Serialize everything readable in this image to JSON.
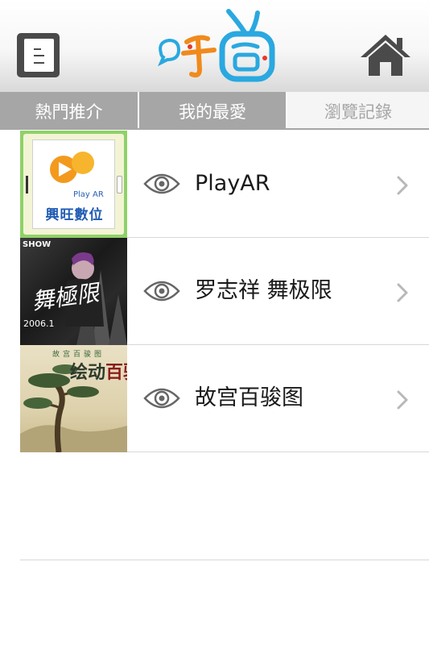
{
  "header": {
    "menu_icon": "notebook-icon",
    "logo_icon": "brand-logo",
    "home_icon": "home-icon"
  },
  "tabs": [
    {
      "label": "熱門推介",
      "active": false
    },
    {
      "label": "我的最愛",
      "active": false
    },
    {
      "label": "瀏覽記錄",
      "active": true
    }
  ],
  "history": [
    {
      "title": "PlayAR",
      "thumb_text": {
        "sub": "Play AR",
        "name": "興旺數位"
      }
    },
    {
      "title": "罗志祥 舞极限",
      "thumb_text": {
        "show": "SHOW",
        "script": "舞極限",
        "date": "2006.1"
      }
    },
    {
      "title": "故宫百骏图",
      "thumb_text": {
        "top": "故宫百骏图",
        "title_a": "绘动",
        "title_b": "百骏"
      }
    }
  ],
  "colors": {
    "tab_inactive": "#a6a6a6",
    "tab_active_bg": "#f5f5f5",
    "divider": "#d8d8d8",
    "icon_gray": "#4a4a4a",
    "logo_blue": "#2aa8e0",
    "logo_orange": "#f08a1c"
  }
}
